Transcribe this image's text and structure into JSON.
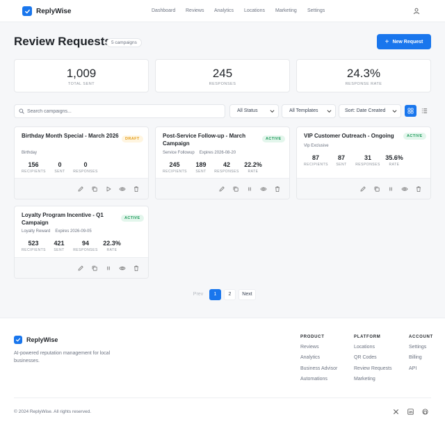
{
  "brand": {
    "name": "ReplyWise",
    "accent": "#1976ed"
  },
  "nav": [
    "Dashboard",
    "Reviews",
    "Analytics",
    "Locations",
    "Marketing",
    "Settings"
  ],
  "page": {
    "title": "Review Requests",
    "campaign_count": "5 campaigns",
    "new_button": "New Request"
  },
  "stats": [
    {
      "value": "1,009",
      "label": "TOTAL SENT"
    },
    {
      "value": "245",
      "label": "RESPONSES"
    },
    {
      "value": "24.3%",
      "label": "RESPONSE RATE"
    }
  ],
  "toolbar": {
    "search_placeholder": "Search campaigns...",
    "status_filter": "All Status",
    "template_filter": "All Templates",
    "sort": "Sort: Date Created"
  },
  "cards": [
    {
      "title": "Birthday Month Special - March 2026",
      "status": "DRAFT",
      "meta": [
        "Birthday"
      ],
      "metrics": [
        {
          "value": "156",
          "label": "RECIPIENTS"
        },
        {
          "value": "0",
          "label": "SENT"
        },
        {
          "value": "0",
          "label": "RESPONSES"
        }
      ],
      "actions": [
        "edit-icon",
        "copy-icon",
        "play-icon",
        "eye-icon",
        "trash-icon"
      ]
    },
    {
      "title": "Post-Service Follow-up - March Campaign",
      "status": "ACTIVE",
      "meta": [
        "Service Followup",
        "Expires 2026-08-20"
      ],
      "metrics": [
        {
          "value": "245",
          "label": "RECIPIENTS"
        },
        {
          "value": "189",
          "label": "SENT"
        },
        {
          "value": "42",
          "label": "RESPONSES"
        },
        {
          "value": "22.2%",
          "label": "RATE"
        }
      ],
      "actions": [
        "edit-icon",
        "copy-icon",
        "pause-icon",
        "eye-icon",
        "trash-icon"
      ]
    },
    {
      "title": "VIP Customer Outreach - Ongoing",
      "status": "ACTIVE",
      "meta": [
        "Vip Exclusive"
      ],
      "metrics": [
        {
          "value": "87",
          "label": "RECIPIENTS"
        },
        {
          "value": "87",
          "label": "SENT"
        },
        {
          "value": "31",
          "label": "RESPONSES"
        },
        {
          "value": "35.6%",
          "label": "RATE"
        }
      ],
      "actions": [
        "edit-icon",
        "copy-icon",
        "pause-icon",
        "eye-icon",
        "trash-icon"
      ]
    },
    {
      "title": "Loyalty Program Incentive - Q1 Campaign",
      "status": "ACTIVE",
      "meta": [
        "Loyalty Reward",
        "Expires 2026-09-05"
      ],
      "metrics": [
        {
          "value": "523",
          "label": "RECIPIENTS"
        },
        {
          "value": "421",
          "label": "SENT"
        },
        {
          "value": "94",
          "label": "RESPONSES"
        },
        {
          "value": "22.3%",
          "label": "RATE"
        }
      ],
      "actions": [
        "edit-icon",
        "copy-icon",
        "pause-icon",
        "eye-icon",
        "trash-icon"
      ]
    }
  ],
  "pagination": {
    "prev": "Prev",
    "pages": [
      "1",
      "2"
    ],
    "current": "1",
    "next": "Next"
  },
  "footer": {
    "tagline": "AI-powered reputation management for local businesses.",
    "columns": [
      {
        "heading": "PRODUCT",
        "links": [
          "Reviews",
          "Analytics",
          "Business Advisor",
          "Automations"
        ]
      },
      {
        "heading": "PLATFORM",
        "links": [
          "Locations",
          "QR Codes",
          "Review Requests",
          "Marketing"
        ]
      },
      {
        "heading": "ACCOUNT",
        "links": [
          "Settings",
          "Billing",
          "API"
        ]
      }
    ],
    "copyright": "© 2024 ReplyWise. All rights reserved.",
    "social": [
      "x-icon",
      "linkedin-icon",
      "github-icon"
    ]
  }
}
